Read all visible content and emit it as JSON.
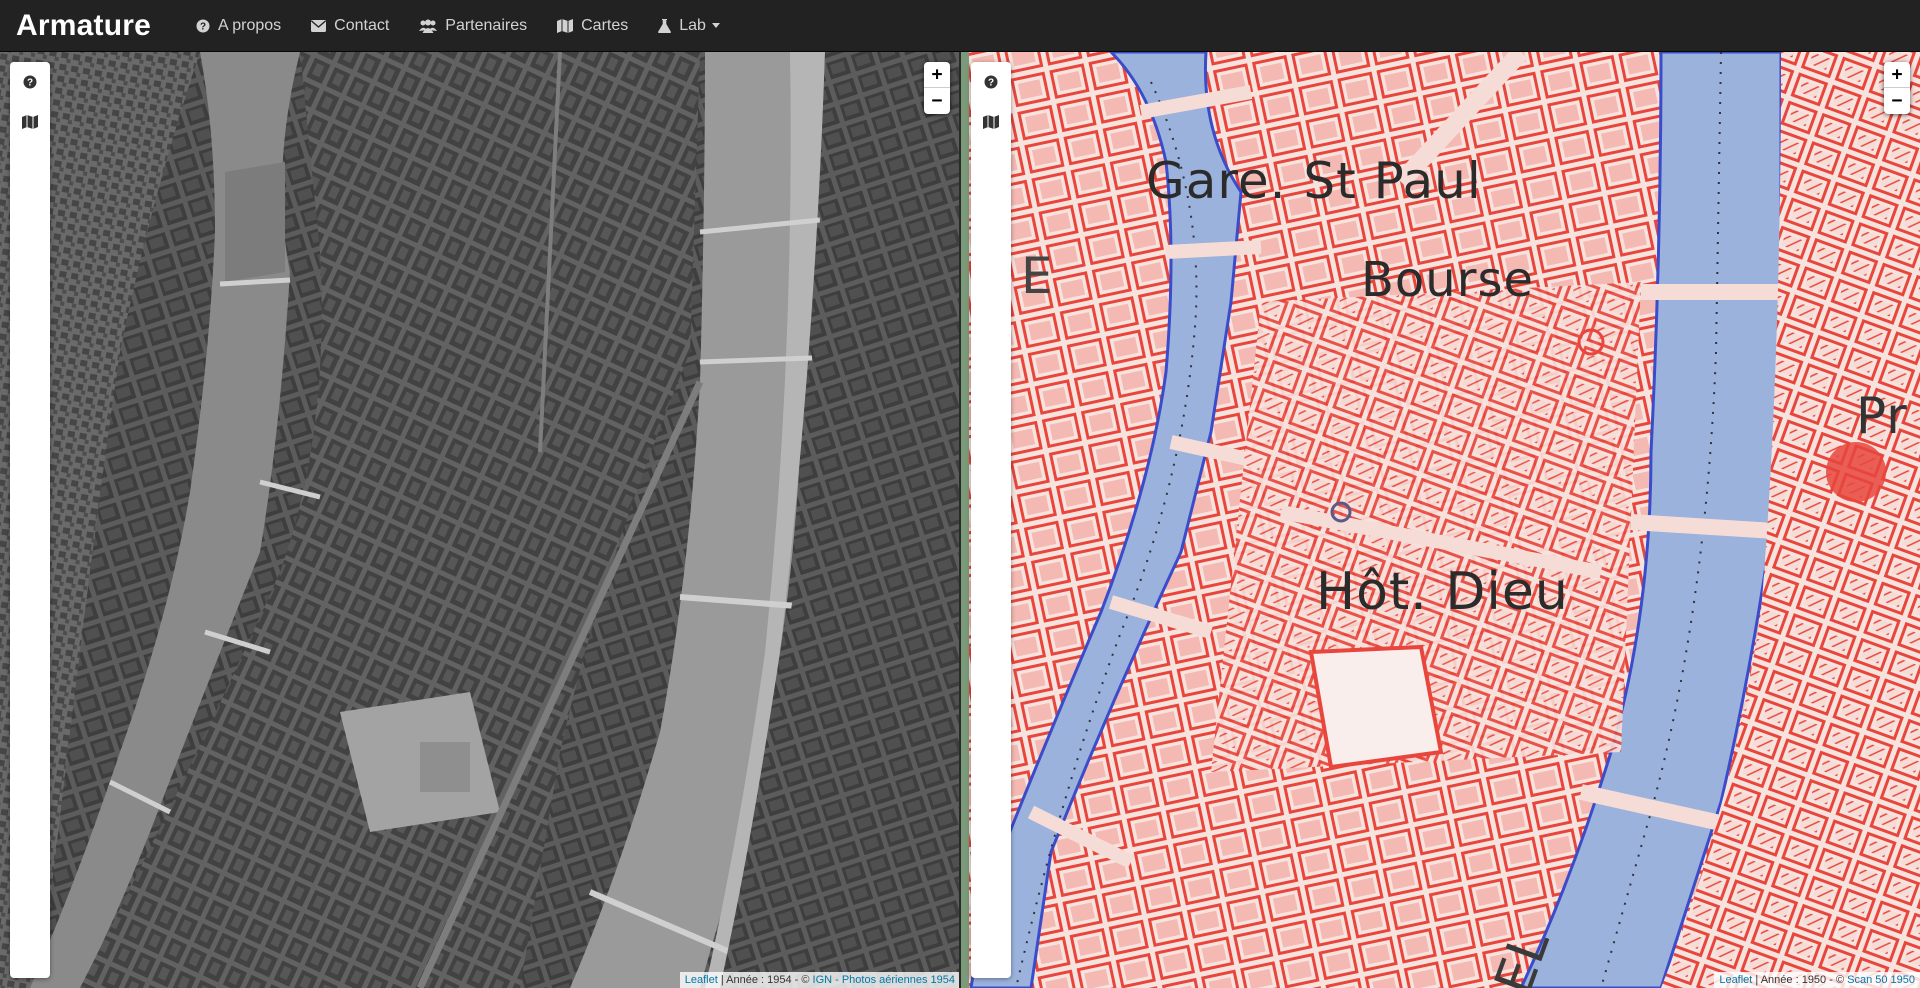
{
  "navbar": {
    "brand": "Armature",
    "items": [
      {
        "label": "A propos",
        "icon": "question-circle-icon"
      },
      {
        "label": "Contact",
        "icon": "envelope-icon"
      },
      {
        "label": "Partenaires",
        "icon": "users-icon"
      },
      {
        "label": "Cartes",
        "icon": "map-icon"
      },
      {
        "label": "Lab",
        "icon": "flask-icon"
      }
    ],
    "background": "#222222",
    "text_color": "#d2d2d2"
  },
  "left_map": {
    "zoom_in": "+",
    "zoom_out": "−",
    "attribution": {
      "leaflet": "Leaflet",
      "text": " | Année : 1954 - © ",
      "source": "IGN - Photos aériennes 1954"
    },
    "style": "grayscale aerial photo"
  },
  "right_map": {
    "zoom_in": "+",
    "zoom_out": "−",
    "attribution": {
      "leaflet": "Leaflet",
      "text": " | Année : 1950 - © ",
      "source": "Scan 50 1950"
    },
    "labels": {
      "gare": "Gare. St Paul",
      "bourse": "Bourse",
      "hotel_dieu": "Hôt. Dieu",
      "edge_left": "E",
      "edge_right": "Pr",
      "bottom": "EL"
    },
    "colors": {
      "buildings": "#e8463d",
      "river": "#9bb2dc",
      "background": "#f6dcd6"
    }
  }
}
